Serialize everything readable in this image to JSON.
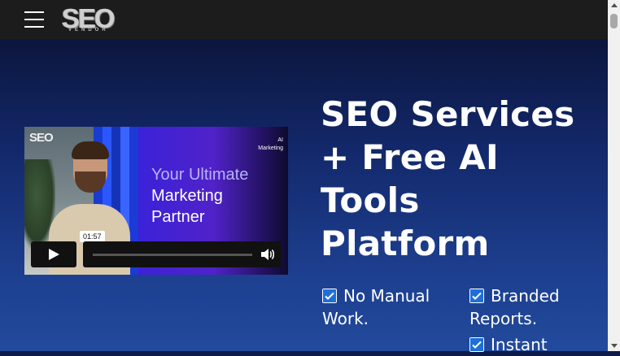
{
  "header": {
    "menu_icon": "hamburger-icon",
    "logo_text": "SEO",
    "logo_subtext": "VENDOR"
  },
  "video": {
    "logo_text": "SEO",
    "tag_line1": "AI",
    "tag_line2": "Marketing",
    "headline_line1": "Your Ultimate",
    "headline_line2": "Marketing",
    "headline_line3": "Partner",
    "time": "01:57"
  },
  "hero": {
    "headline": "SEO Services + Free AI Tools Platform",
    "features": [
      {
        "label": "No Manual Work."
      },
      {
        "label": "Branded Reports."
      },
      {
        "label": "Instant"
      }
    ]
  },
  "colors": {
    "topbar": "#1c1c1c",
    "hero_bg": "#13286a",
    "check_blue": "#1e6fd9"
  }
}
